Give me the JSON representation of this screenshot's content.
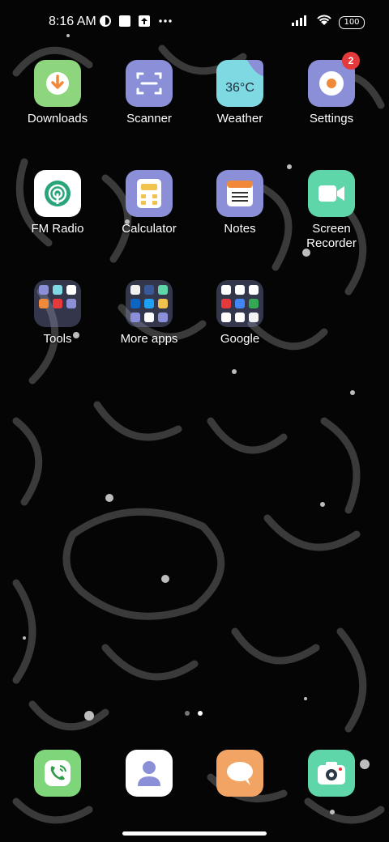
{
  "status_bar": {
    "time": "8:16 AM",
    "battery": "100",
    "more_icon": "more-horizontal-icon"
  },
  "home_apps": [
    {
      "label": "Downloads"
    },
    {
      "label": "Scanner"
    },
    {
      "label": "Weather",
      "temp": "36°C"
    },
    {
      "label": "Settings",
      "badge": "2"
    },
    {
      "label": "FM Radio"
    },
    {
      "label": "Calculator"
    },
    {
      "label": "Notes"
    },
    {
      "label": "Screen Recorder"
    }
  ],
  "folders": [
    {
      "label": "Tools"
    },
    {
      "label": "More apps"
    },
    {
      "label": "Google"
    }
  ],
  "dock": [
    {
      "name": "phone"
    },
    {
      "name": "contacts"
    },
    {
      "name": "messages"
    },
    {
      "name": "camera"
    }
  ],
  "colors": {
    "downloads": "#8ed67e",
    "scanner": "#8a8fd8",
    "weather": "#7ed9e3",
    "settings": "#8a8fd8",
    "calculator": "#8a8fd8",
    "notes": "#8a8fd8",
    "recorder": "#5fd6a9",
    "phone": "#7fd67a",
    "messages": "#f2a464",
    "camera": "#5fd6a9",
    "badge": "#e5393b"
  }
}
